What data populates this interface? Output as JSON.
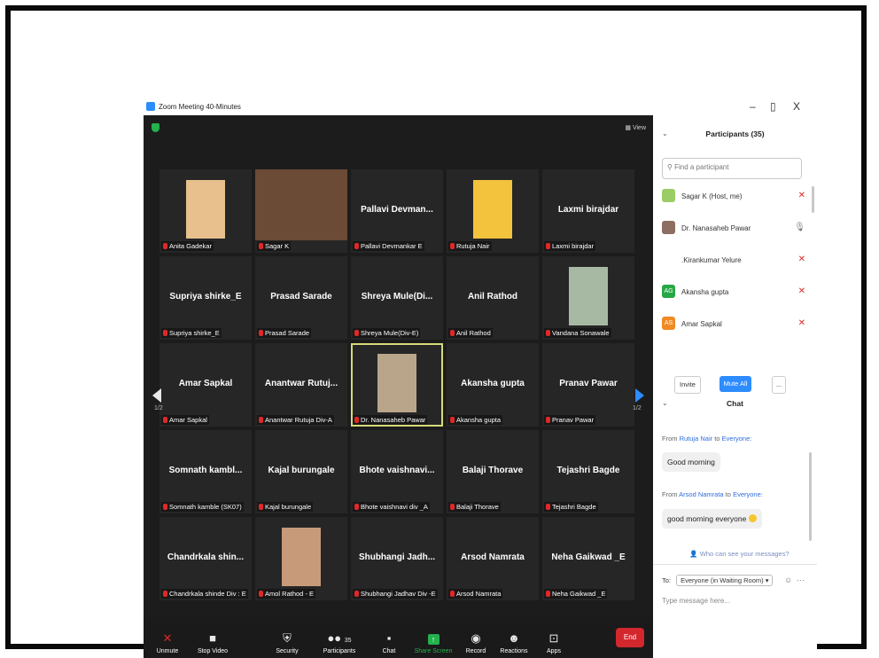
{
  "window": {
    "title": "Zoom Meeting 40-Minutes",
    "min": "–",
    "restore": "▯",
    "close": "X",
    "view_label": "View"
  },
  "tiles": [
    {
      "display": "",
      "label": "Anita Gadekar",
      "photo": "#e7c08d"
    },
    {
      "display": "",
      "label": "Sagar K",
      "photo": "#6b4a36"
    },
    {
      "display": "Pallavi  Devman...",
      "label": "Pallavi Devmankar E"
    },
    {
      "display": "",
      "label": "Rutuja Nair",
      "photo": "#f3c33d"
    },
    {
      "display": "Laxmi birajdar",
      "label": "Laxmi birajdar"
    },
    {
      "display": "Supriya shirke_E",
      "label": "Supriya shirke_E"
    },
    {
      "display": "Prasad Sarade",
      "label": "Prasad Sarade"
    },
    {
      "display": "Shreya  Mule(Di...",
      "label": "Shreya Mule(Div-E)"
    },
    {
      "display": "Anil Rathod",
      "label": "Anil Rathod"
    },
    {
      "display": "",
      "label": "Vandana Sonawale",
      "photo": "#a7b9a2"
    },
    {
      "display": "Amar Sapkal",
      "label": "Amar Sapkal"
    },
    {
      "display": "Anantwar  Rutuj...",
      "label": "Anantwar Rutuja Div-A"
    },
    {
      "display": "",
      "label": "Dr. Nanasaheb Pawar",
      "photo": "#b9a68a"
    },
    {
      "display": "Akansha gupta",
      "label": "Akansha gupta"
    },
    {
      "display": "Pranav Pawar",
      "label": "Pranav Pawar"
    },
    {
      "display": "Somnath  kambl...",
      "label": "Somnath kamble (SK07)"
    },
    {
      "display": "Kajal burungale",
      "label": "Kajal burungale"
    },
    {
      "display": "Bhote  vaishnavi...",
      "label": "Bhote vaishnavi div _A"
    },
    {
      "display": "Balaji Thorave",
      "label": "Balaji Thorave"
    },
    {
      "display": "Tejashri Bagde",
      "label": "Tejashri Bagde"
    },
    {
      "display": "Chandrkala  shin...",
      "label": "Chandrkala shinde Div : E"
    },
    {
      "display": "",
      "label": "Amol Rathod - E",
      "photo": "#c79a7a"
    },
    {
      "display": "Shubhangi  Jadh...",
      "label": "Shubhangi Jadhav Div -E"
    },
    {
      "display": "Arsod Namrata",
      "label": "Arsod Namrata"
    },
    {
      "display": "Neha Gaikwad _E",
      "label": "Neha Gaikwad _E"
    }
  ],
  "pager": {
    "left": "1/2",
    "right": "1/2"
  },
  "toolbar": {
    "unmute": "Unmute",
    "stop_video": "Stop Video",
    "security": "Security",
    "participants": "Participants",
    "participants_count": "35",
    "chat": "Chat",
    "share_screen": "Share Screen",
    "record": "Record",
    "reactions": "Reactions",
    "apps": "Apps",
    "end": "End"
  },
  "participants_panel": {
    "title": "Participants (35)",
    "search_placeholder": "Find a participant",
    "list": [
      {
        "name": "Sagar K (Host, me)",
        "initials": "",
        "color": "#9ccc65"
      },
      {
        "name": "Dr. Nanasaheb Pawar",
        "initials": "",
        "color": "#8d6e63"
      },
      {
        "name": ".Kirankumar Yelure",
        "initials": "",
        "color": "#ffffff"
      },
      {
        "name": "Akansha gupta",
        "initials": "AG",
        "color": "#28a745"
      },
      {
        "name": "Amar Sapkal",
        "initials": "AS",
        "color": "#f08a24"
      }
    ],
    "invite": "Invite",
    "mute_all": "Mute All",
    "more": "..."
  },
  "chat": {
    "title": "Chat",
    "messages": [
      {
        "from_label": "From",
        "sender": "Rutuja Nair",
        "to_label": "to",
        "recipient": "Everyone:",
        "text": "Good morning"
      },
      {
        "from_label": "From",
        "sender": "Arsod Namrata",
        "to_label": "to",
        "recipient": "Everyone:",
        "text": "good morning everyone"
      }
    ],
    "hint": "Who can see your messages?",
    "to_label": "To:",
    "to_value": "Everyone (in Waiting Room) ▾",
    "placeholder": "Type message here..."
  },
  "colors": {
    "accent": "#2d8cff",
    "end": "#d3272e",
    "muted_mic": "#e02828",
    "share_green": "#23b14d"
  }
}
